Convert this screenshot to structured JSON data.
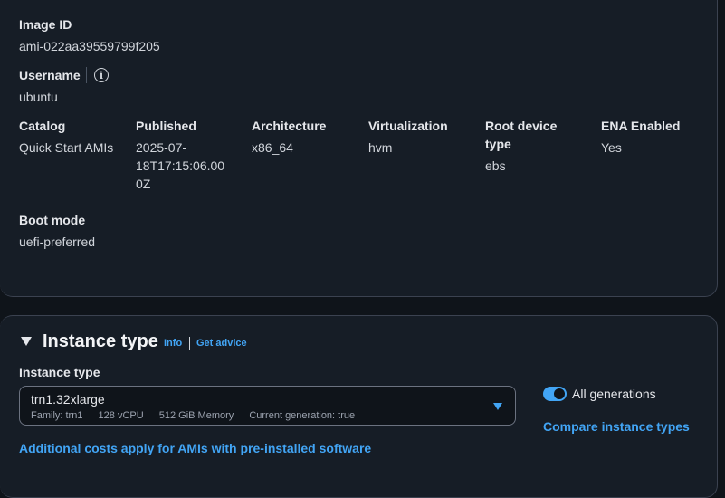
{
  "ami": {
    "image_id_label": "Image ID",
    "image_id": "ami-022aa39559799f205",
    "username_label": "Username",
    "username": "ubuntu",
    "catalog_label": "Catalog",
    "catalog": "Quick Start AMIs",
    "published_label": "Published",
    "published": [
      "2025-07-",
      "18T17:15:06.00",
      "0Z"
    ],
    "architecture_label": "Architecture",
    "architecture": "x86_64",
    "virtualization_label": "Virtualization",
    "virtualization": "hvm",
    "root_device_label": [
      "Root device",
      "type"
    ],
    "root_device": "ebs",
    "ena_label": "ENA Enabled",
    "ena": "Yes",
    "boot_mode_label": "Boot mode",
    "boot_mode": "uefi-preferred"
  },
  "instance_type": {
    "title": "Instance type",
    "info_link": "Info",
    "advice_link": "Get advice",
    "field_label": "Instance type",
    "selected": "trn1.32xlarge",
    "meta": [
      "Family: trn1",
      "128 vCPU",
      "512 GiB Memory",
      "Current generation: true"
    ],
    "all_generations_label": "All generations",
    "all_generations_enabled": true,
    "compare_link": "Compare instance types",
    "costs_link": "Additional costs apply for AMIs with pre-installed software"
  },
  "colors": {
    "accent": "#42a5f5",
    "background": "#0f141a",
    "panel": "#161d26"
  }
}
